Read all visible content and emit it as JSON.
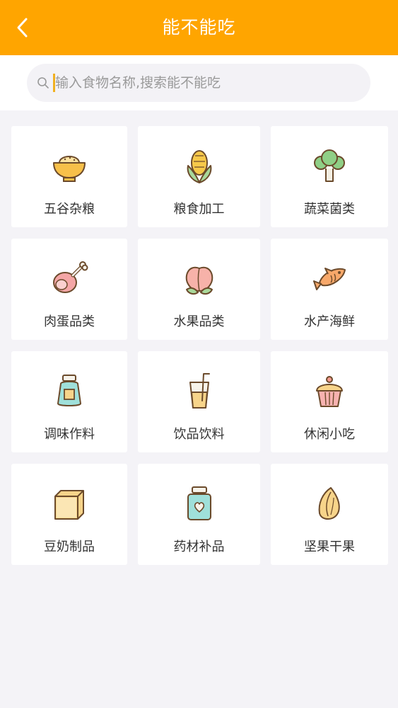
{
  "header": {
    "title": "能不能吃",
    "back_icon": "chevron-left-icon",
    "background": "#ffa500"
  },
  "search": {
    "placeholder": "输入食物名称,搜索能不能吃",
    "value": "",
    "icon": "search-icon"
  },
  "categories": [
    {
      "label": "五谷杂粮",
      "icon": "rice-bowl-icon"
    },
    {
      "label": "粮食加工",
      "icon": "corn-icon"
    },
    {
      "label": "蔬菜菌类",
      "icon": "broccoli-icon"
    },
    {
      "label": "肉蛋品类",
      "icon": "ham-icon"
    },
    {
      "label": "水果品类",
      "icon": "peach-icon"
    },
    {
      "label": "水产海鲜",
      "icon": "fish-icon"
    },
    {
      "label": "调味作料",
      "icon": "seasoning-jar-icon"
    },
    {
      "label": "饮品饮料",
      "icon": "drink-cup-icon"
    },
    {
      "label": "休闲小吃",
      "icon": "cupcake-icon"
    },
    {
      "label": "豆奶制品",
      "icon": "tofu-icon"
    },
    {
      "label": "药材补品",
      "icon": "supplement-jar-icon"
    },
    {
      "label": "坚果干果",
      "icon": "almond-icon"
    }
  ],
  "colors": {
    "accent": "#ffa500",
    "card_background": "#ffffff",
    "page_background": "#f4f3f7"
  }
}
